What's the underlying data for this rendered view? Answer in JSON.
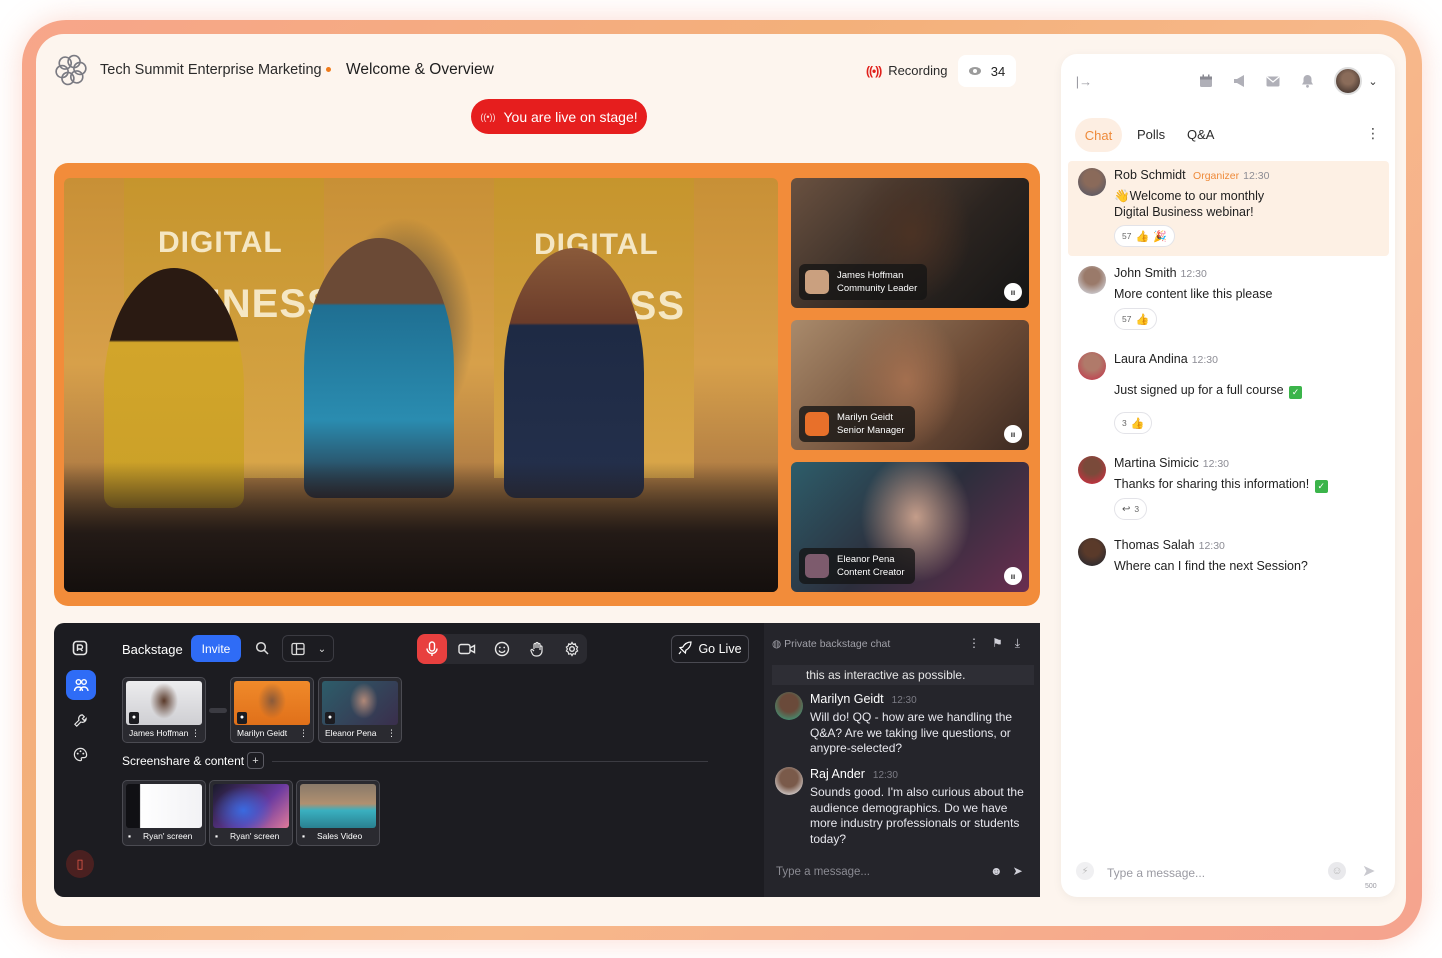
{
  "header": {
    "event_title": "Tech Summit Enterprise Marketing",
    "session_title": "Welcome & Overview",
    "recording_label": "Recording",
    "viewer_count": "34",
    "live_banner": "You are live on stage!"
  },
  "stage": {
    "banner_words": [
      "DIGITAL",
      "SINESS",
      "DIGITAL",
      "INESS"
    ],
    "speakers": [
      {
        "name": "James Hoffman",
        "role": "Community Leader"
      },
      {
        "name": "Marilyn Geidt",
        "role": "Senior Manager"
      },
      {
        "name": "Eleanor Pena",
        "role": "Content Creator"
      }
    ]
  },
  "backstage": {
    "title": "Backstage",
    "invite_label": "Invite",
    "go_live_label": "Go Live",
    "participants": [
      "James Hoffman",
      "Marilyn Geidt",
      "Eleanor Pena"
    ],
    "screenshare_label": "Screenshare & content",
    "screenshare_add": "+",
    "content_items": [
      "Ryan' screen",
      "Ryan' screen",
      "Sales Video"
    ],
    "chat": {
      "header": "Private backstage chat",
      "previous_line": "this as interactive as possible.",
      "messages": [
        {
          "author": "Marilyn Geidt",
          "time": "12:30",
          "text": "Will do! QQ - how are we handling the Q&A? Are we taking live questions, or anypre-selected?"
        },
        {
          "author": "Raj Ander",
          "time": "12:30",
          "text": "Sounds good. I'm also curious about the audience demographics. Do we have more industry professionals or students today?"
        }
      ],
      "input_placeholder": "Type a message..."
    }
  },
  "side_chat": {
    "tabs": [
      "Chat",
      "Polls",
      "Q&A"
    ],
    "messages": [
      {
        "author": "Rob Schmidt",
        "role": "Organizer",
        "time": "12:30",
        "text_line1": "Welcome to our monthly",
        "text_line2": "Digital Business webinar!",
        "reaction_count": "57"
      },
      {
        "author": "John Smith",
        "time": "12:30",
        "text": "More content like this please",
        "reaction_count": "57"
      },
      {
        "author": "Laura Andina",
        "time": "12:30",
        "text": "Just signed up for a full course",
        "reaction_count": "3"
      },
      {
        "author": "Martina Simicic",
        "time": "12:30",
        "text": "Thanks for sharing this information!",
        "reply_count": "3"
      },
      {
        "author": "Thomas Salah",
        "time": "12:30",
        "text": "Where can I find the next Session?"
      }
    ],
    "input_placeholder": "Type a message...",
    "char_limit": "500"
  },
  "colors": {
    "accent_orange": "#f28c3a",
    "live_red": "#e61e1e",
    "backstage_blue": "#2f6cf6",
    "backstage_bg": "#1c1c21"
  },
  "icons": {
    "header": [
      "logo-icon",
      "recording-icon",
      "eye-icon"
    ],
    "side_top": [
      "collapse-panel-icon",
      "calendar-icon",
      "megaphone-icon",
      "mail-icon",
      "bell-icon",
      "chevron-down-icon"
    ]
  }
}
